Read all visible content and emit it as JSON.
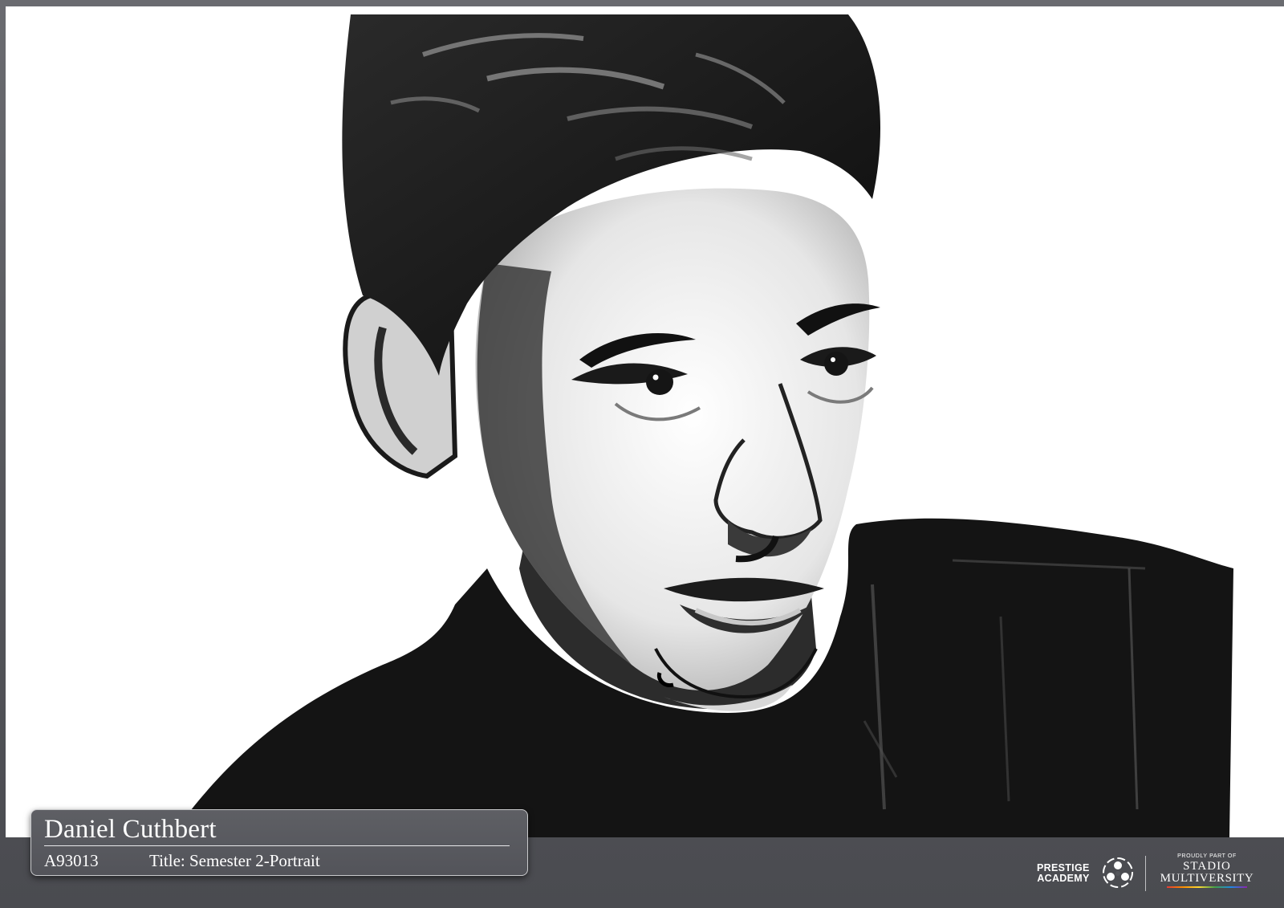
{
  "caption": {
    "name": "Daniel Cuthbert",
    "student_id": "A93013",
    "title": "Title: Semester 2-Portrait"
  },
  "branding": {
    "prestige_line1": "PRESTIGE",
    "prestige_line2": "ACADEMY",
    "proudly_part_of": "PROUDLY PART OF",
    "stadio_line1": "STADIO",
    "stadio_line2": "MULTIVERSITY"
  },
  "artwork": {
    "icon": "charcoal-portrait-drawing"
  },
  "colors": {
    "frame": "#55565b",
    "caption_card": "#5a5b60",
    "text": "#ffffff"
  }
}
